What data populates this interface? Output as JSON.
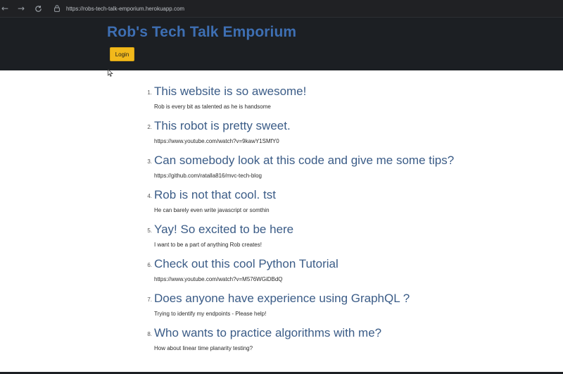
{
  "browser": {
    "url": "https://robs-tech-talk-emporium.herokuapp.com",
    "icons": {
      "back": "arrow-left-icon",
      "forward": "arrow-right-icon",
      "reload": "reload-icon",
      "lock": "lock-icon"
    }
  },
  "header": {
    "title": "Rob's Tech Talk Emporium",
    "login_label": "Login"
  },
  "posts": [
    {
      "number": "1.",
      "title": "This website is so awesome!",
      "body": "Rob is every bit as talented as he is handsome"
    },
    {
      "number": "2.",
      "title": "This robot is pretty sweet.",
      "body": "https://www.youtube.com/watch?v=9kawY1SMfY0"
    },
    {
      "number": "3.",
      "title": "Can somebody look at this code and give me some tips?",
      "body": "https://github.com/ratalla816/mvc-tech-blog"
    },
    {
      "number": "4.",
      "title": "Rob is not that cool. tst",
      "body": "He can barely even write javascript or somthin"
    },
    {
      "number": "5.",
      "title": "Yay! So excited to be here",
      "body": "I want to be a part of anything Rob creates!"
    },
    {
      "number": "6.",
      "title": "Check out this cool Python Tutorial",
      "body": "https://www.youtube.com/watch?v=M576WGiDBdQ"
    },
    {
      "number": "7.",
      "title": "Does anyone have experience using GraphQL ?",
      "body": "Trying to identify my endpoints - Please help!"
    },
    {
      "number": "8.",
      "title": "Who wants to practice algorithms with me?",
      "body": "How about linear time planarity testing?"
    }
  ],
  "colors": {
    "header_bg": "#1c1f23",
    "title": "#3e6fb3",
    "login_button": "#f2b91b",
    "post_title": "#3b5c87"
  }
}
